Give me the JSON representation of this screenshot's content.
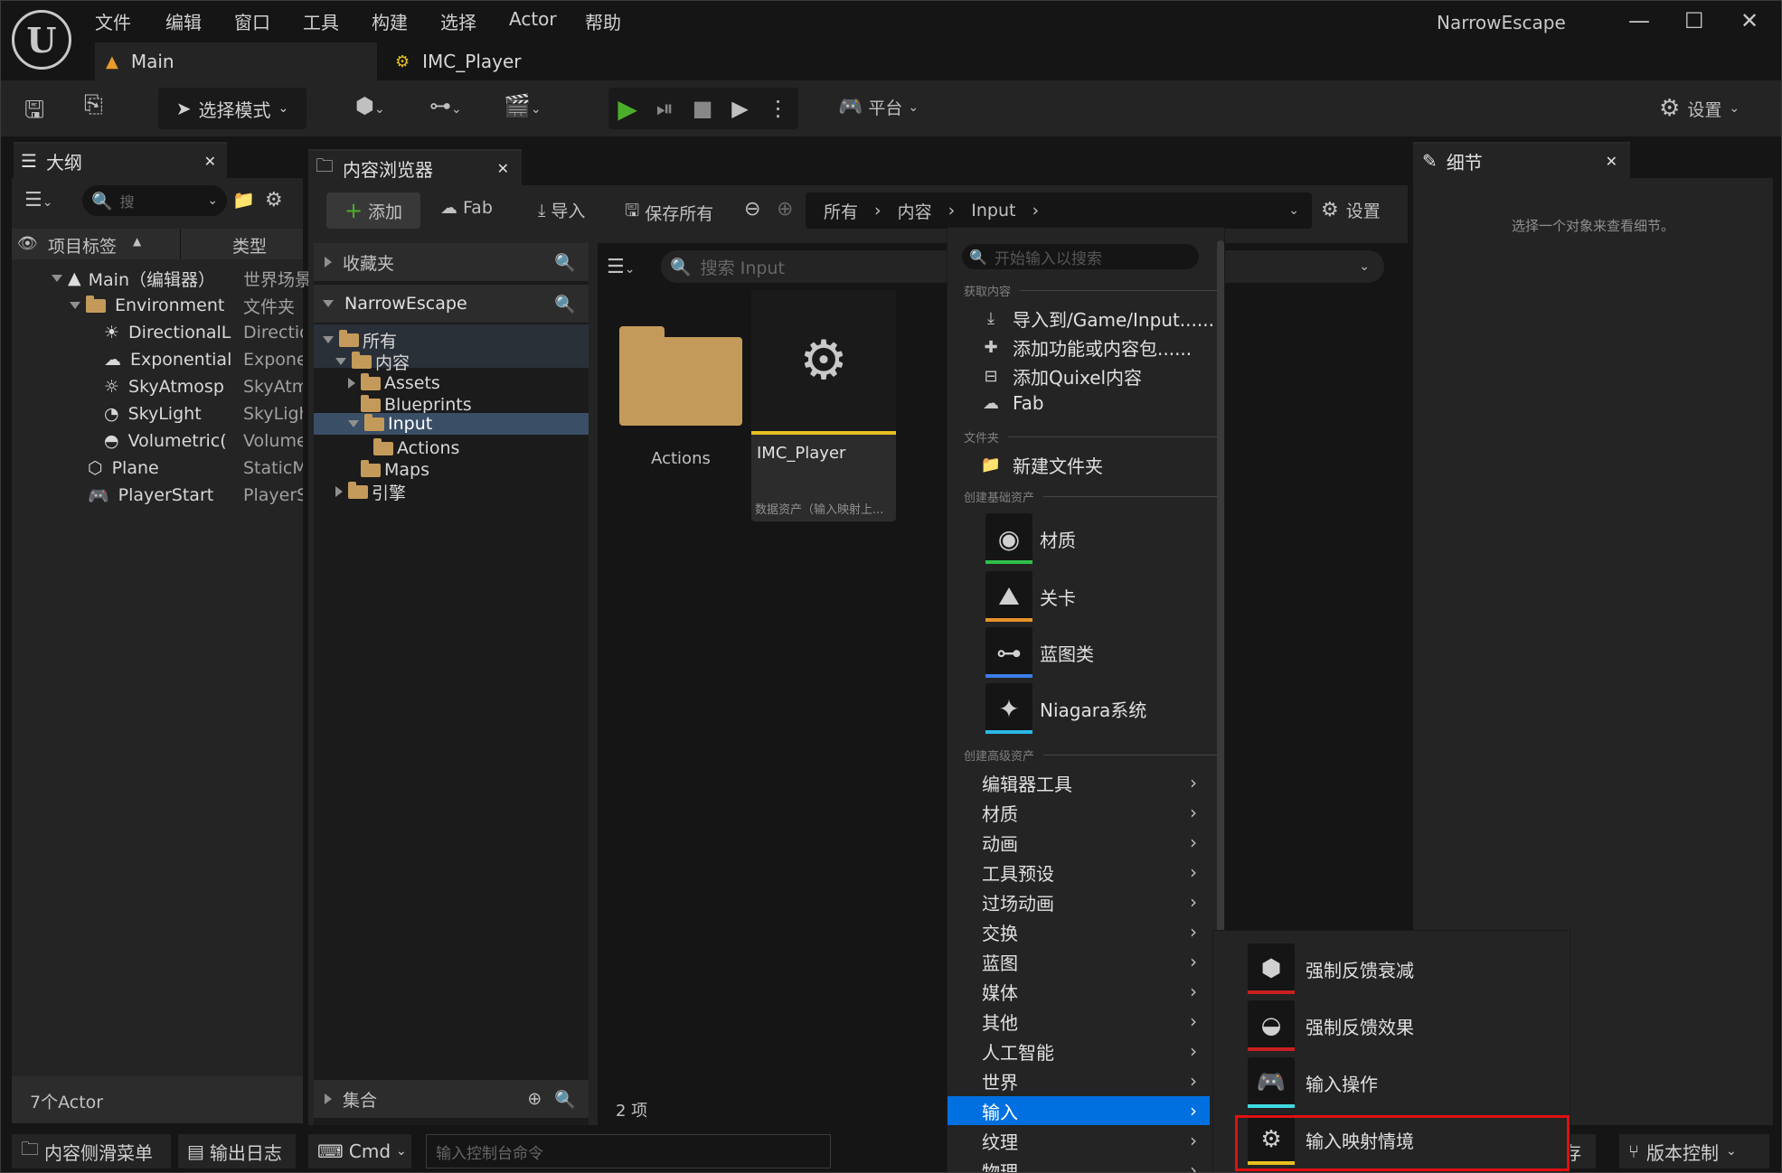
{
  "window": {
    "title": "NarrowEscape",
    "menu": [
      "文件",
      "编辑",
      "窗口",
      "工具",
      "构建",
      "选择",
      "Actor",
      "帮助"
    ],
    "tabs": [
      {
        "label": "Main",
        "active": true
      },
      {
        "label": "IMC_Player",
        "active": false
      }
    ],
    "controls": {
      "minimize": "—",
      "maximize": "☐",
      "close": "✕"
    }
  },
  "toolbar": {
    "mode_label": "选择模式",
    "platform_label": "平台",
    "settings_label": "设置"
  },
  "outliner": {
    "tab_label": "大纲",
    "search_placeholder": "搜",
    "col_label": "项目标签",
    "col_type": "类型",
    "rows": [
      {
        "label": "Main（编辑器）",
        "type": "世界场景",
        "icon": "level-icon",
        "indent": 0
      },
      {
        "label": "Environment",
        "type": "文件夹",
        "icon": "folder-icon",
        "indent": 1
      },
      {
        "label": "DirectionalL",
        "type": "Directio",
        "icon": "sun-icon",
        "indent": 2
      },
      {
        "label": "Exponential",
        "type": "Exponen",
        "icon": "fog-icon",
        "indent": 2
      },
      {
        "label": "SkyAtmosp",
        "type": "SkyAtm",
        "icon": "sky-icon",
        "indent": 2
      },
      {
        "label": "SkyLight",
        "type": "SkyLigh",
        "icon": "skylight-icon",
        "indent": 2
      },
      {
        "label": "Volumetric(",
        "type": "Volume",
        "icon": "cloud-icon",
        "indent": 2
      },
      {
        "label": "Plane",
        "type": "StaticM",
        "icon": "mesh-icon",
        "indent": 1
      },
      {
        "label": "PlayerStart",
        "type": "PlayerS",
        "icon": "gamepad-icon",
        "indent": 1
      }
    ],
    "footer": "7个Actor"
  },
  "content_browser": {
    "tab_label": "内容浏览器",
    "add_label": "添加",
    "fab_label": "Fab",
    "import_label": "导入",
    "save_all_label": "保存所有",
    "breadcrumb": [
      "所有",
      "内容",
      "Input"
    ],
    "settings_label": "设置",
    "favorites_label": "收藏夹",
    "project_label": "NarrowEscape",
    "tree": [
      {
        "label": "所有",
        "indent": 0,
        "arrow": "down"
      },
      {
        "label": "内容",
        "indent": 1,
        "arrow": "down"
      },
      {
        "label": "Assets",
        "indent": 2,
        "arrow": "right"
      },
      {
        "label": "Blueprints",
        "indent": 2,
        "arrow": "none"
      },
      {
        "label": "Input",
        "indent": 2,
        "arrow": "down",
        "selected": true
      },
      {
        "label": "Actions",
        "indent": 3,
        "arrow": "none"
      },
      {
        "label": "Maps",
        "indent": 2,
        "arrow": "none"
      },
      {
        "label": "引擎",
        "indent": 0,
        "arrow": "right"
      }
    ],
    "collections_label": "集合",
    "search_placeholder": "搜索 Input",
    "assets": [
      {
        "label": "Actions",
        "kind": "folder"
      },
      {
        "label": "IMC_Player",
        "kind": "asset",
        "subtitle": "数据资产（输入映射上..."
      }
    ],
    "item_count": "2 项"
  },
  "context_menu": {
    "search_placeholder": "开始输入以搜索",
    "section_get": "获取内容",
    "get_items": [
      {
        "label": "导入到/Game/Input......",
        "icon": "import-icon"
      },
      {
        "label": "添加功能或内容包......",
        "icon": "pack-icon"
      },
      {
        "label": "添加Quixel内容",
        "icon": "quixel-icon"
      },
      {
        "label": "Fab",
        "icon": "fab-icon"
      }
    ],
    "section_folder": "文件夹",
    "new_folder": "新建文件夹",
    "section_basic": "创建基础资产",
    "basic_items": [
      {
        "label": "材质",
        "icon": "material-icon",
        "color": "#2fbf4a"
      },
      {
        "label": "关卡",
        "icon": "level-icon",
        "color": "#e8922a"
      },
      {
        "label": "蓝图类",
        "icon": "blueprint-icon",
        "color": "#3a7ee8"
      },
      {
        "label": "Niagara系统",
        "icon": "niagara-icon",
        "color": "#2ab8e8"
      }
    ],
    "section_advanced": "创建高级资产",
    "advanced_items": [
      "编辑器工具",
      "材质",
      "动画",
      "工具预设",
      "过场动画",
      "交换",
      "蓝图",
      "媒体",
      "其他",
      "人工智能",
      "世界",
      "输入",
      "纹理",
      "物理"
    ],
    "highlighted_item": "输入"
  },
  "submenu": {
    "items": [
      {
        "label": "强制反馈衰减",
        "icon": "feedback-attenuation-icon",
        "color": "#c82020"
      },
      {
        "label": "强制反馈效果",
        "icon": "feedback-effect-icon",
        "color": "#c82020"
      },
      {
        "label": "输入操作",
        "icon": "input-action-icon",
        "color": "#40d8e0"
      },
      {
        "label": "输入映射情境",
        "icon": "input-mapping-icon",
        "color": "#e8c020",
        "highlighted": true
      }
    ]
  },
  "details": {
    "tab_label": "细节",
    "empty_text": "选择一个对象来查看细节。"
  },
  "statusbar": {
    "content_drawer": "内容侧滑菜单",
    "output_log": "输出日志",
    "cmd": "Cmd",
    "console_placeholder": "输入控制台命令",
    "save_partial": "存",
    "source_control": "版本控制"
  },
  "colors": {
    "accent_blue": "#0070e0",
    "play_green": "#4caf2a",
    "highlight_red": "#e01010"
  }
}
